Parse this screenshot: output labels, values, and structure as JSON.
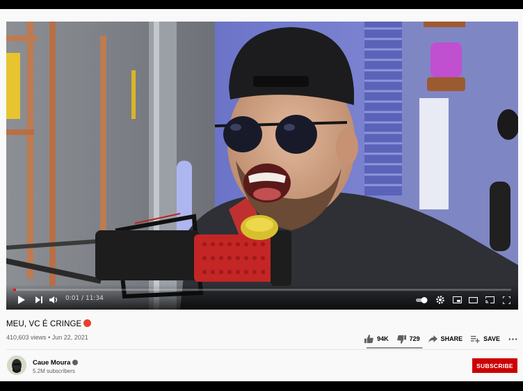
{
  "video": {
    "title": "MEU, VC É CRINGE",
    "title_emoji": "angry-face-emoji",
    "views": "410,603 views",
    "separator": "•",
    "date": "Jun 22, 2021",
    "progress_fraction": 0.0015
  },
  "player": {
    "time_display": "0:01 / 11:34",
    "icons": {
      "play": "play-icon",
      "next": "next-icon",
      "volume": "volume-icon",
      "autoplay": "autoplay-toggle-icon",
      "settings": "settings-gear-icon",
      "miniplayer": "miniplayer-icon",
      "theater": "theater-mode-icon",
      "cast": "cast-icon",
      "fullscreen": "fullscreen-icon"
    }
  },
  "actions": {
    "likes": "94K",
    "dislikes": "729",
    "share_label": "SHARE",
    "save_label": "SAVE",
    "like_ratio": 0.992
  },
  "channel": {
    "name": "Caue Moura",
    "subscribers": "5.2M subscribers",
    "subscribe_label": "SUBSCRIBE"
  },
  "colors": {
    "brand_red": "#cc0000",
    "progress_red": "#ff0000",
    "text_primary": "#030303",
    "text_secondary": "#606060"
  }
}
